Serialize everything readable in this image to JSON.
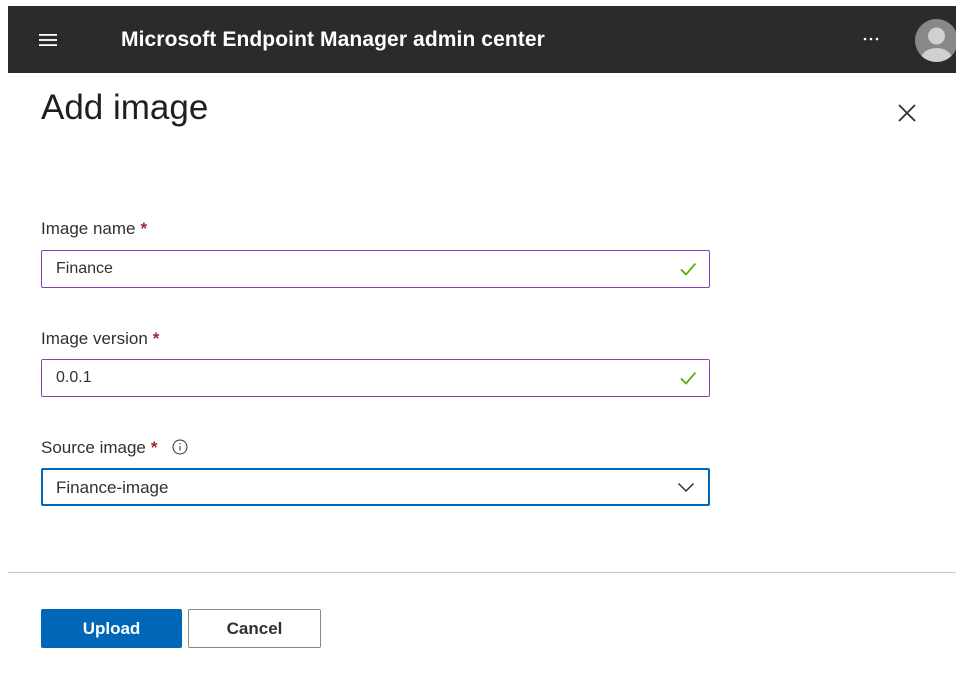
{
  "header": {
    "app_title": "Microsoft Endpoint Manager admin center",
    "menu_icon": "hamburger-menu-icon",
    "more_icon": "ellipsis-icon",
    "more_label": "...",
    "avatar_icon": "user-avatar-icon",
    "background_color": "#2b2b2b"
  },
  "panel": {
    "title": "Add image",
    "close_icon": "close-icon"
  },
  "form": {
    "image_name": {
      "label": "Image name",
      "required_marker": "*",
      "value": "Finance",
      "status_icon": "checkmark-icon"
    },
    "image_version": {
      "label": "Image version",
      "required_marker": "*",
      "value": "0.0.1",
      "status_icon": "checkmark-icon"
    },
    "source_image": {
      "label": "Source image",
      "required_marker": "*",
      "info_icon": "info-icon",
      "selected": "Finance-image",
      "dropdown_icon": "chevron-down-icon"
    }
  },
  "footer": {
    "upload_label": "Upload",
    "cancel_label": "Cancel"
  },
  "colors": {
    "accent": "#0067b8",
    "valid_field_border": "#8a3fb3",
    "check": "#57a300",
    "required": "#a4262c"
  }
}
